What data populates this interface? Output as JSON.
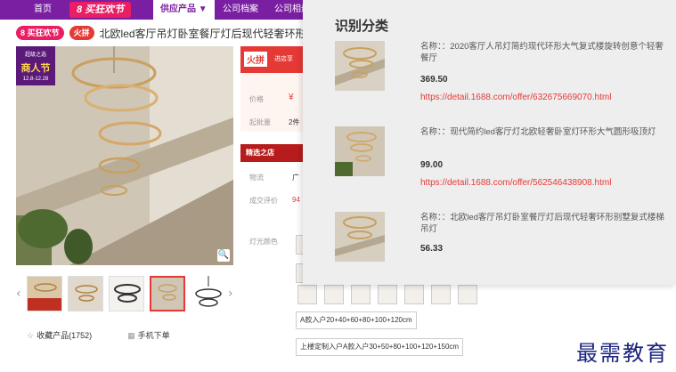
{
  "nav": {
    "home": "首页",
    "promo": "8 买狂欢节",
    "supply": "供应产品 ▼",
    "archive": "公司档案",
    "album": "公司相册"
  },
  "title": {
    "badge1": "8 买狂欢节",
    "badge2": "火拼",
    "text": "北欧led客厅吊灯卧室餐厅灯后现代轻奢环形创"
  },
  "main_image": {
    "badge_line1": "超级之选",
    "badge_line2": "商人节",
    "badge_line3": "12.8-12.28"
  },
  "mid": {
    "flash_logo": "火拼",
    "flash_text": "进店享",
    "price_label": "价格",
    "price_symbol": "¥",
    "qty_label": "起批量",
    "qty_value": "2件",
    "store_label": "精选之店",
    "ship_label": "物流",
    "ship_value": "广",
    "review_label": "成交评价",
    "review_value": "94",
    "light_label": "灯光颜色",
    "option1": "A款入户20+40+60+80+100+120cm",
    "option2": "上楼定制入户A款入户30+50+80+100+120+150cm"
  },
  "actions": {
    "favorite": "收藏产品(1752)",
    "mobile": "手机下单"
  },
  "panel": {
    "title": "识别分类",
    "results": [
      {
        "name": "名称：：2020客厅人吊灯简约现代环形大气复式楼旋转创意个轻奢餐厅",
        "price": "369.50",
        "link": "https://detail.1688.com/offer/632675669070.html"
      },
      {
        "name": "名称：：现代简约led客厅灯北欧轻奢卧室灯环形大气圆形吸顶灯",
        "price": "99.00",
        "link": "https://detail.1688.com/offer/562546438908.html"
      },
      {
        "name": "名称：：北欧led客厅吊灯卧室餐厅灯后现代轻奢环形别墅复式楼梯吊灯",
        "price": "56.33",
        "link": ""
      }
    ]
  },
  "watermark": "最需教育"
}
